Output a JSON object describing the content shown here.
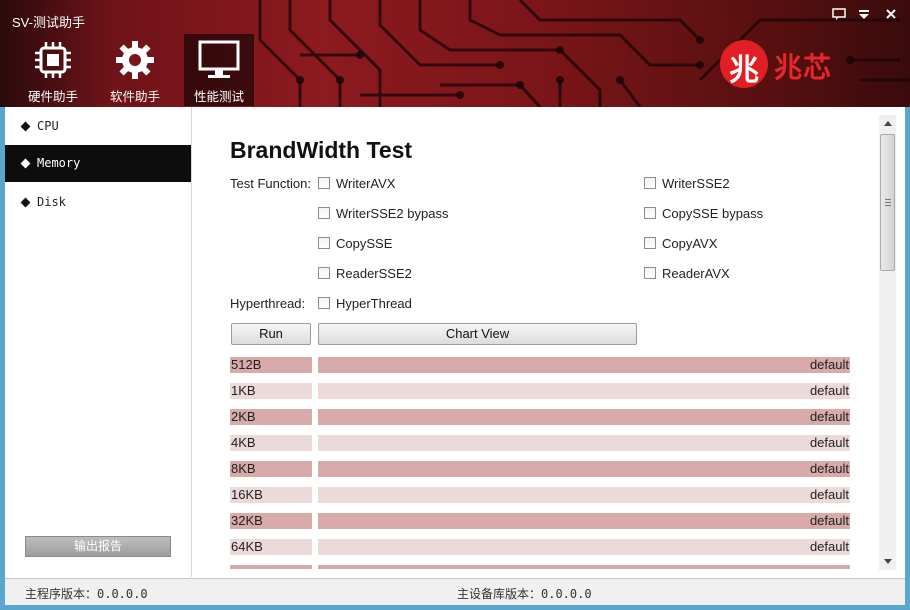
{
  "window": {
    "title": "SV-测试助手",
    "controls": {
      "feedback": "▭",
      "menu": "▾",
      "minimize": "▼",
      "close": "✕"
    }
  },
  "toolbar": {
    "items": [
      {
        "label": "硬件助手",
        "icon": "chip-icon",
        "active": false
      },
      {
        "label": "软件助手",
        "icon": "gear-icon",
        "active": false
      },
      {
        "label": "性能测试",
        "icon": "monitor-icon",
        "active": true
      }
    ]
  },
  "logo": {
    "mark": "兆",
    "text": "兆芯",
    "color": "#e01e24"
  },
  "sidebar": {
    "items": [
      {
        "label": "CPU",
        "active": false
      },
      {
        "label": "Memory",
        "active": true
      },
      {
        "label": "Disk",
        "active": false
      }
    ],
    "export_label": "输出报告"
  },
  "main": {
    "heading": "BrandWidth Test",
    "test_function_label": "Test Function:",
    "hyperthread_label": "Hyperthread:",
    "checkboxes": [
      {
        "label": "WriterAVX",
        "checked": false
      },
      {
        "label": "WriterSSE2",
        "checked": false
      },
      {
        "label": "WriterSSE2 bypass",
        "checked": false
      },
      {
        "label": "CopySSE bypass",
        "checked": false
      },
      {
        "label": "CopySSE",
        "checked": false
      },
      {
        "label": "CopyAVX",
        "checked": false
      },
      {
        "label": "ReaderSSE2",
        "checked": false
      },
      {
        "label": "ReaderAVX",
        "checked": false
      }
    ],
    "hyperthread_checkbox": {
      "label": "HyperThread",
      "checked": false
    },
    "run_label": "Run",
    "chart_view_label": "Chart View",
    "results": [
      {
        "size": "512B",
        "value": "default"
      },
      {
        "size": "1KB",
        "value": "default"
      },
      {
        "size": "2KB",
        "value": "default"
      },
      {
        "size": "4KB",
        "value": "default"
      },
      {
        "size": "8KB",
        "value": "default"
      },
      {
        "size": "16KB",
        "value": "default"
      },
      {
        "size": "32KB",
        "value": "default"
      },
      {
        "size": "64KB",
        "value": "default"
      }
    ],
    "row_colors": {
      "dark": "#d8aaaa",
      "light": "#ecdada"
    }
  },
  "status": {
    "main_version": "主程序版本：0.0.0.0",
    "db_version": "主设备库版本：0.0.0.0"
  }
}
